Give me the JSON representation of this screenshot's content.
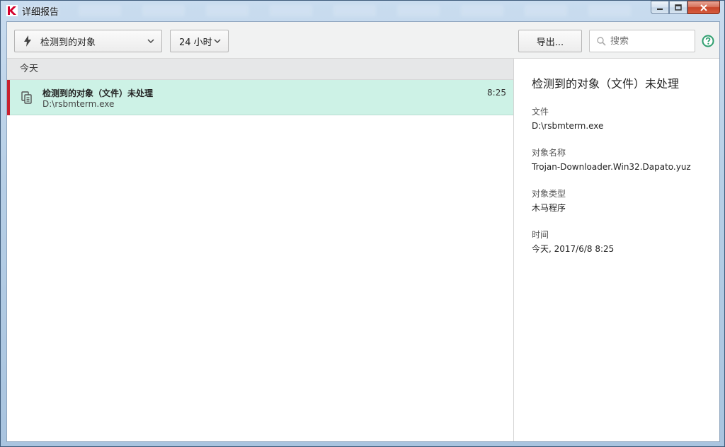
{
  "window": {
    "title": "详细报告"
  },
  "toolbar": {
    "filter_dropdown": {
      "label": "检测到的对象",
      "icon": "lightning-icon"
    },
    "time_dropdown": {
      "label": "24 小时"
    },
    "export_label": "导出...",
    "search": {
      "placeholder": "搜索"
    },
    "help_icon": "help-icon"
  },
  "list": {
    "group_label": "今天",
    "items": [
      {
        "title": "检测到的对象（文件）未处理",
        "subtitle": "D:\\rsbmterm.exe",
        "time": "8:25",
        "status_color": "#c8202f"
      }
    ]
  },
  "details": {
    "title": "检测到的对象（文件）未处理",
    "fields": [
      {
        "label": "文件",
        "value": "D:\\rsbmterm.exe"
      },
      {
        "label": "对象名称",
        "value": "Trojan-Downloader.Win32.Dapato.yuz"
      },
      {
        "label": "对象类型",
        "value": "木马程序"
      },
      {
        "label": "时间",
        "value": "今天, 2017/6/8 8:25"
      }
    ]
  },
  "colors": {
    "selected_row": "#cdf2e6",
    "alert_marker": "#c8202f",
    "help_green": "#2e9e6e"
  }
}
